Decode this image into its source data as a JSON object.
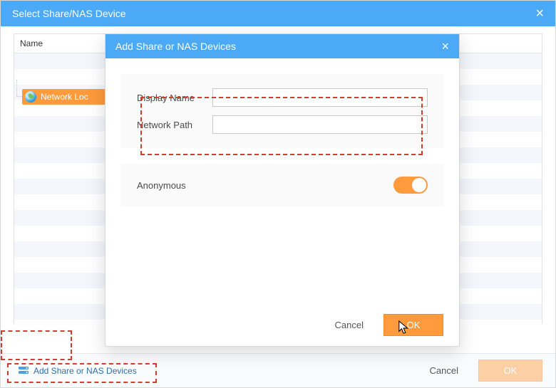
{
  "window": {
    "title": "Select Share/NAS Device",
    "columns": {
      "name": "Name"
    },
    "tree": {
      "network_location": "Network Loc"
    }
  },
  "footer": {
    "add_link": "Add Share or NAS Devices",
    "cancel": "Cancel",
    "ok": "OK"
  },
  "modal": {
    "title": "Add Share or NAS Devices",
    "display_name_label": "Display Name",
    "display_name_value": "",
    "network_path_label": "Network Path",
    "network_path_value": "",
    "anonymous_label": "Anonymous",
    "anonymous_on": true,
    "cancel": "Cancel",
    "ok": "OK"
  }
}
